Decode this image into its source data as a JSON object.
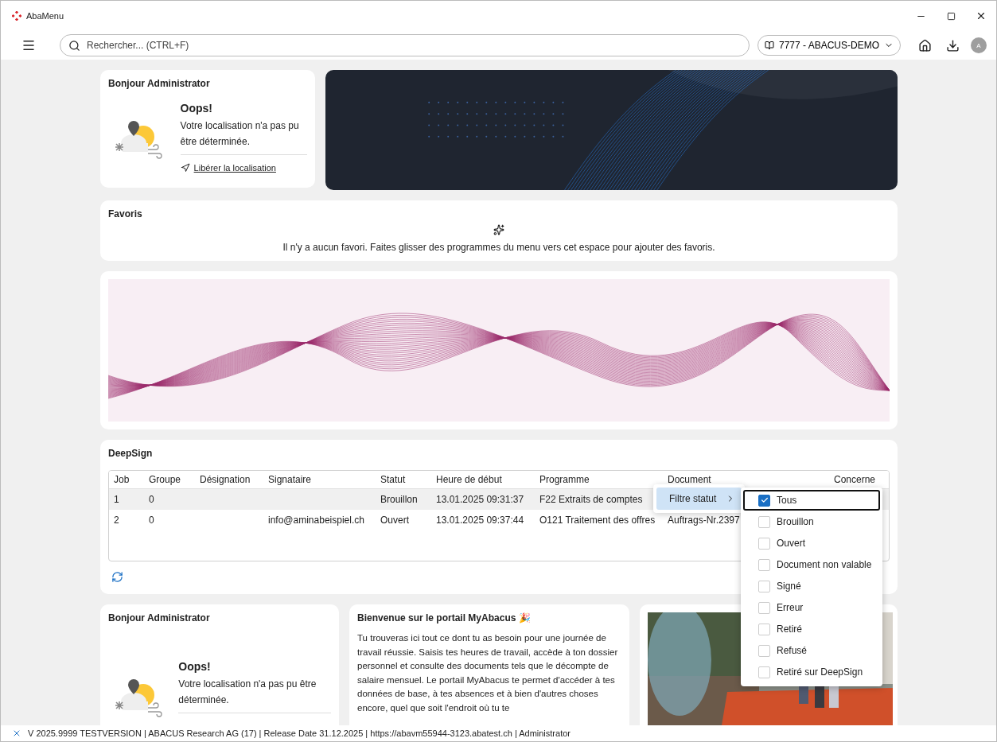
{
  "window": {
    "title": "AbaMenu"
  },
  "toolbar": {
    "search": {
      "placeholder": "Rechercher... (CTRL+F)"
    },
    "mandant": "7777 - ABACUS-DEMO",
    "avatar": "A"
  },
  "greeting": {
    "title": "Bonjour Administrator",
    "heading": "Oops!",
    "message": "Votre localisation n'a pas pu être déterminée.",
    "link": "Libérer la localisation"
  },
  "favorites": {
    "title": "Favoris",
    "empty_message": "Il n'y a aucun favori. Faites glisser des programmes du menu vers cet espace pour ajouter des favoris."
  },
  "deepsign": {
    "title": "DeepSign",
    "columns": [
      "Job",
      "Groupe",
      "Désignation",
      "Signataire",
      "Statut",
      "Heure de début",
      "Programme",
      "Document",
      "Concerne"
    ],
    "rows": [
      {
        "selected": true,
        "cells": [
          "1",
          "0",
          "",
          "",
          "Brouillon",
          "13.01.2025 09:31:37",
          "F22 Extraits de comptes",
          "",
          ""
        ]
      },
      {
        "selected": false,
        "cells": [
          "2",
          "0",
          "",
          "info@aminabeispiel.ch",
          "Ouvert",
          "13.01.2025 09:37:44",
          "O121 Traitement des offres",
          "Auftrags-Nr.2397",
          ""
        ]
      }
    ]
  },
  "context_menu": {
    "label": "Filtre statut",
    "options": [
      {
        "label": "Tous",
        "checked": true,
        "focused": true
      },
      {
        "label": "Brouillon",
        "checked": false,
        "focused": false
      },
      {
        "label": "Ouvert",
        "checked": false,
        "focused": false
      },
      {
        "label": "Document non valable",
        "checked": false,
        "focused": false
      },
      {
        "label": "Signé",
        "checked": false,
        "focused": false
      },
      {
        "label": "Erreur",
        "checked": false,
        "focused": false
      },
      {
        "label": "Retiré",
        "checked": false,
        "focused": false
      },
      {
        "label": "Refusé",
        "checked": false,
        "focused": false
      },
      {
        "label": "Retiré sur DeepSign",
        "checked": false,
        "focused": false
      }
    ]
  },
  "greeting_2": {
    "title": "Bonjour Administrator",
    "heading": "Oops!",
    "message": "Votre localisation n'a pas pu être déterminée."
  },
  "welcome": {
    "title": "Bienvenue sur le portail MyAbacus",
    "title_icon": "🎉",
    "text": "Tu trouveras ici tout ce dont tu as besoin pour une journée de travail réussie. Saisis tes heures de travail, accède à ton dossier personnel et consulte des documents tels que le décompte de salaire mensuel. Le portail MyAbacus te permet d'accéder à tes données de base, à tes absences et à bien d'autres choses encore, quel que soit l'endroit où tu te"
  },
  "status_bar": "V 2025.9999 TESTVERSION | ABACUS Research AG (17) | Release Date 31.12.2025 | https://abavm55944-3123.abatest.ch | Administrator"
}
